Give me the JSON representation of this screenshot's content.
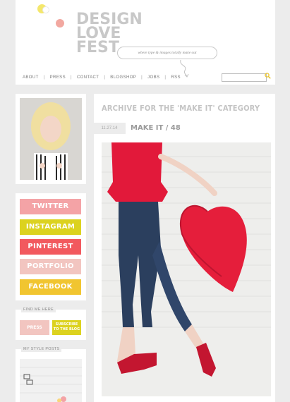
{
  "logo": {
    "text": "DESIGN\nLOVE\nFEST",
    "tagline": "where type & images totally make out"
  },
  "nav": {
    "items": [
      "ABOUT",
      "PRESS",
      "CONTACT",
      "BLOGSHOP",
      "JOBS",
      "RSS"
    ],
    "separator": "|"
  },
  "search": {
    "placeholder": ""
  },
  "sidebar": {
    "social": [
      {
        "label": "TWITTER",
        "color": "#f4a3a6"
      },
      {
        "label": "INSTAGRAM",
        "color": "#dcd21f"
      },
      {
        "label": "PINTEREST",
        "color": "#f2595e"
      },
      {
        "label": "PORTFOLIO",
        "color": "#f2c5c0"
      },
      {
        "label": "FACEBOOK",
        "color": "#f1c530"
      }
    ],
    "find_me_label": "FIND ME HERE",
    "press_label": "PRESS",
    "subscribe_label": "SUBSCRIBE TO THE BLOG",
    "style_posts_label": "MY STYLE POSTS"
  },
  "main": {
    "archive_title": "ARCHIVE FOR THE 'MAKE IT' CATEGORY",
    "post": {
      "date": "11.27.14",
      "title": "MAKE IT / 48"
    }
  }
}
